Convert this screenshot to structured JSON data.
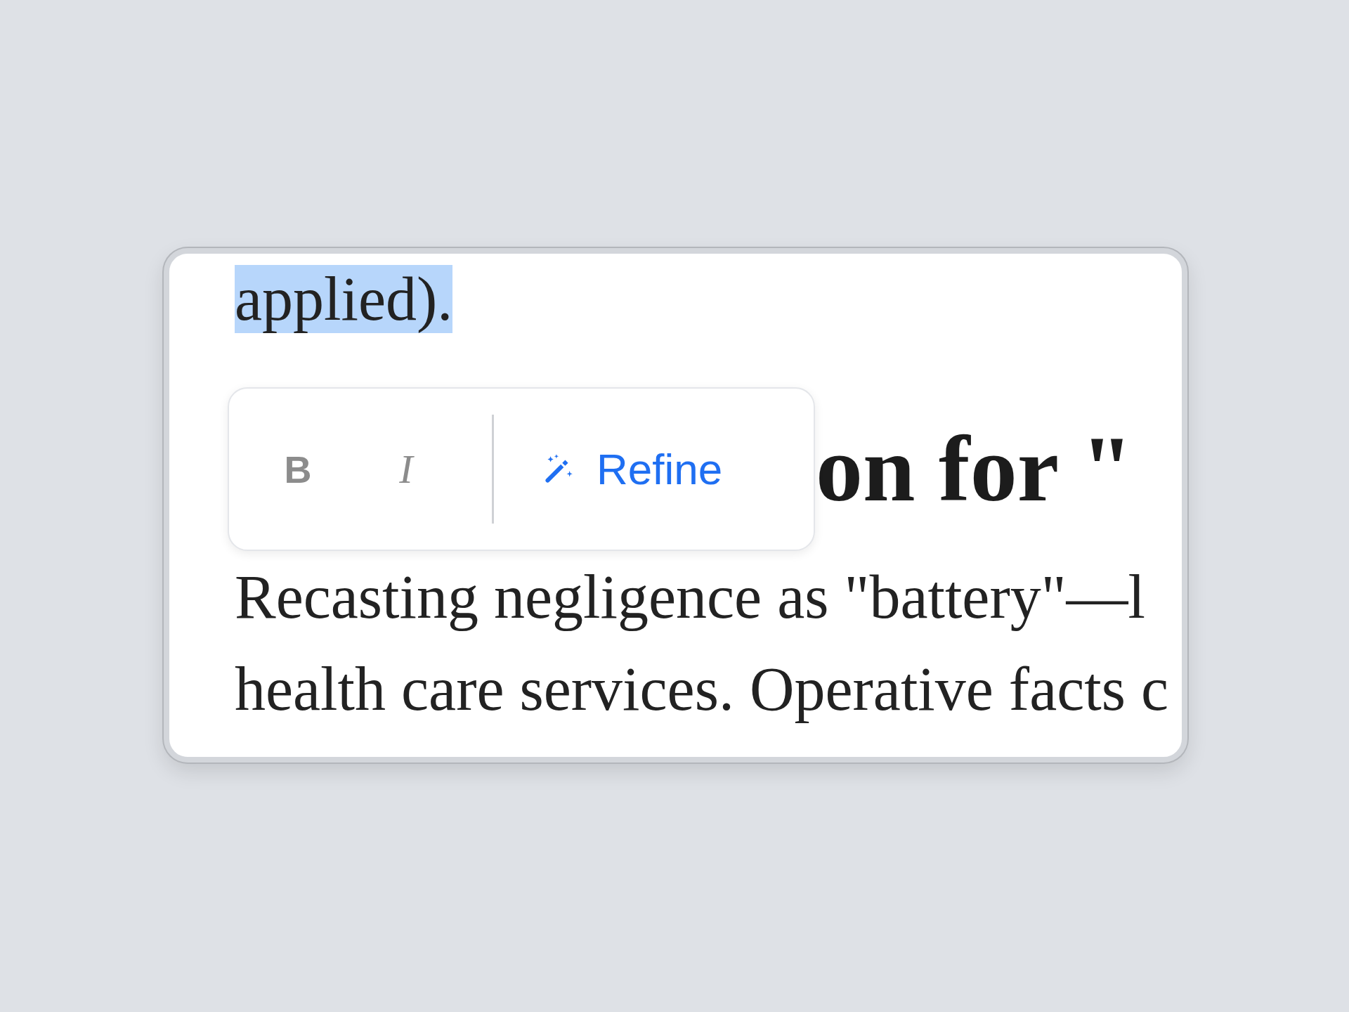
{
  "editor": {
    "blocks": [
      {
        "kind": "paragraph",
        "text": "applied).",
        "selected": true
      },
      {
        "kind": "heading",
        "text": "on for \"",
        "selected": false
      },
      {
        "kind": "paragraph",
        "text": "Recasting negligence as \"battery\"—l",
        "selected": false
      },
      {
        "kind": "paragraph",
        "text": "health care services. Operative facts c",
        "selected": false
      }
    ]
  },
  "toolbar": {
    "buttons": [
      {
        "kind": "bold",
        "label": "B"
      },
      {
        "kind": "italic",
        "label": "I"
      },
      {
        "kind": "refine",
        "label": "Refine"
      }
    ]
  }
}
